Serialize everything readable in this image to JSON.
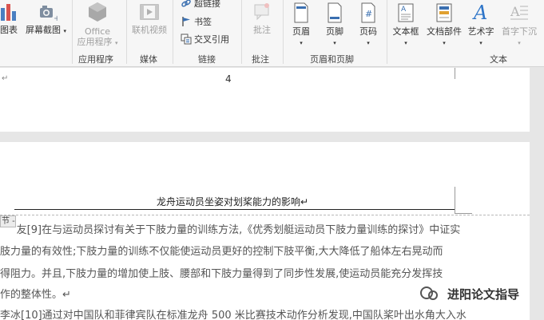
{
  "ribbon": {
    "charts_label": "图表",
    "screenshot_label": "屏幕截图",
    "office_apps_label_1": "Office",
    "office_apps_label_2": "应用程序",
    "online_video_label": "联机视频",
    "hyperlink_label": "超链接",
    "bookmark_label": "书签",
    "crossref_label": "交叉引用",
    "comment_label": "批注",
    "header_label": "页眉",
    "footer_label": "页脚",
    "pagenum_label": "页码",
    "textbox_label": "文本框",
    "quickparts_label": "文档部件",
    "wordart_label": "艺术字",
    "dropcap_label": "首字下沉",
    "group_apps": "应用程序",
    "group_media": "媒体",
    "group_links": "链接",
    "group_comments": "批注",
    "group_headerfooter": "页眉和页脚",
    "group_text": "文本"
  },
  "doc": {
    "page_number": "4",
    "page1_para_mark": "↵",
    "header_text": "龙舟运动员坐姿对划桨能力的影响↵",
    "section_tag": "节 -",
    "line1": "     友[9]在与运动员探讨有关于下肢力量的训练方法,《优秀划艇运动员下肢力量训练的探讨》中证实",
    "line2": "肢力量的有效性;下肢力量的训练不仅能使运动员更好的控制下肢平衡,大大降低了船体左右晃动而",
    "line3": "得阻力。并且,下肢力量的增加使上肢、腰部和下肢力量得到了同步性发展,使运动员能充分发挥技",
    "line4": "作的整体性。↵",
    "line5": "李冰[10]通过对中国队和菲律宾队在标准龙舟 500 米比赛技术动作分析发现,中国队桨叶出水角大入水"
  },
  "watermark": {
    "text": "进阳论文指导"
  }
}
